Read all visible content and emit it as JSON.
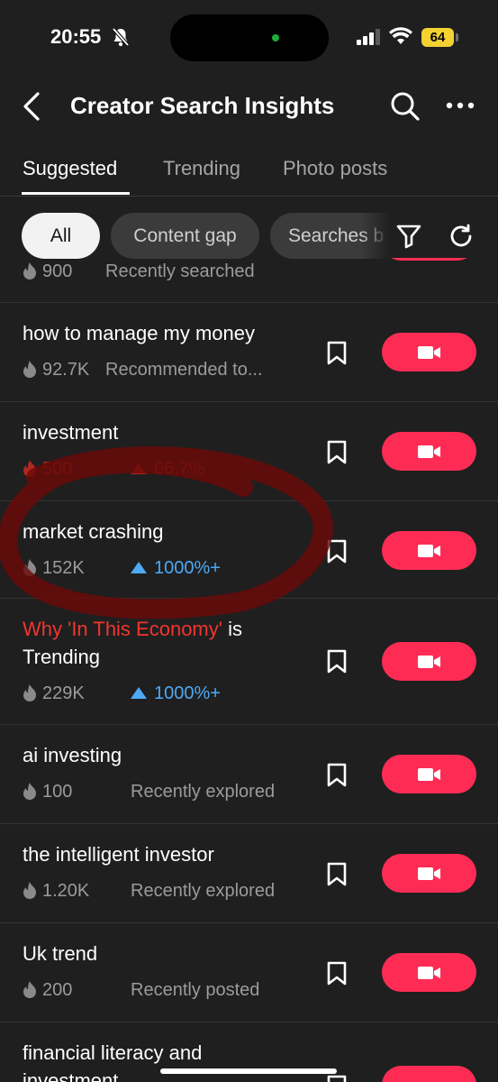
{
  "status_bar": {
    "time": "20:55",
    "battery": "64"
  },
  "header": {
    "title": "Creator Search Insights"
  },
  "tabs": [
    {
      "label": "Suggested",
      "active": true
    },
    {
      "label": "Trending",
      "active": false
    },
    {
      "label": "Photo posts",
      "active": false
    }
  ],
  "filters": [
    {
      "label": "All",
      "selected": true
    },
    {
      "label": "Content gap",
      "selected": false
    },
    {
      "label": "Searches b",
      "selected": false
    }
  ],
  "rows": [
    {
      "keyword": "",
      "views": "900",
      "detail": "Recently searched"
    },
    {
      "keyword": "how to manage my money",
      "views": "92.7K",
      "detail": "Recommended to..."
    },
    {
      "keyword": "investment",
      "views": "500",
      "detail": "66.7%"
    },
    {
      "keyword": "market crashing",
      "views": "152K",
      "detail": "1000%+"
    },
    {
      "keyword_highlight": "Why 'In This Economy'",
      "keyword_rest": " is Trending",
      "views": "229K",
      "detail": "1000%+"
    },
    {
      "keyword": "ai investing",
      "views": "100",
      "detail": "Recently explored"
    },
    {
      "keyword": "the intelligent investor",
      "views": "1.20K",
      "detail": "Recently explored"
    },
    {
      "keyword": "Uk trend",
      "views": "200",
      "detail": "Recently posted"
    },
    {
      "keyword": "financial literacy and investment",
      "views": "",
      "detail": ""
    }
  ],
  "colors": {
    "accent": "#fe2c55",
    "trend_up": "#4ea9f5",
    "highlight": "#f0352f",
    "background": "#1f1f1f"
  }
}
